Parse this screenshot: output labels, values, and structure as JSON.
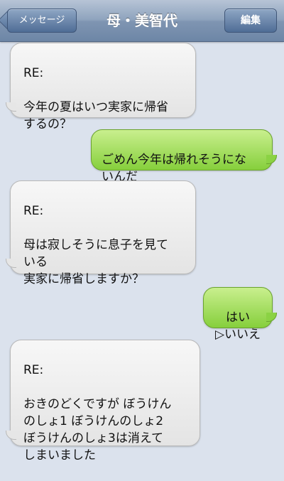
{
  "nav": {
    "back_label": "メッセージ",
    "title": "母・美智代",
    "edit_label": "編集"
  },
  "messages": [
    {
      "from": "mother",
      "header": "RE:",
      "text": "今年の夏はいつ実家に帰省\nするの？"
    },
    {
      "from": "me",
      "text": "ごめん今年は帰れそうにな\nいんだ"
    },
    {
      "from": "mother",
      "header": "RE:",
      "text": "母は寂しそうに息子を見て\nいる\n実家に帰省しますか？"
    },
    {
      "from": "me",
      "text": "はい\n▷いいえ"
    },
    {
      "from": "mother",
      "header": "RE:",
      "text": "おきのどくですが ぼうけん\nのしょ1 ぼうけんのしょ2\nぼうけんのしょ3は消えて\nしまいました"
    }
  ]
}
